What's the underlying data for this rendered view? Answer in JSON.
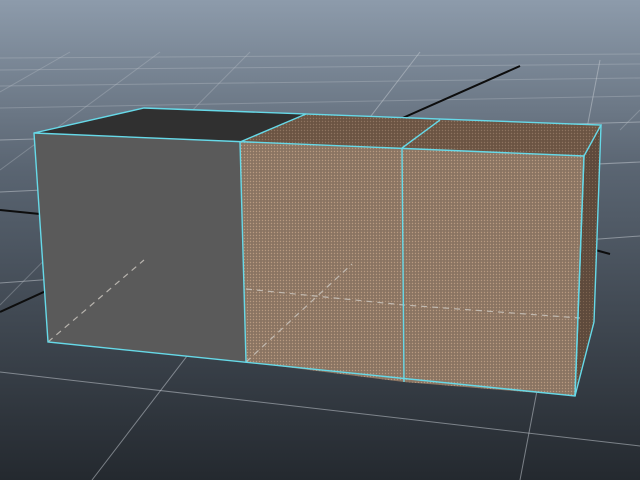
{
  "viewport": {
    "background_top": "#8d9bab",
    "background_bottom": "#24292f",
    "grid_color": "#bfc5cc",
    "axis_color": "#0d0d0d"
  },
  "objects": [
    {
      "name": "cube-unselected",
      "shading": "flat-gray",
      "front_color": "#5a5a5a",
      "top_color": "#303030"
    },
    {
      "name": "cube-selected-1",
      "shading": "face-selected",
      "front_color": "#8a7462",
      "top_color": "#6b5443"
    },
    {
      "name": "cube-selected-2",
      "shading": "face-selected",
      "front_color": "#8a7462",
      "top_color": "#6b5443",
      "side_color": "#5e4a3c"
    }
  ],
  "selection": {
    "wireframe_color": "#66d9e8",
    "face_highlight_color": "#b89a80"
  }
}
